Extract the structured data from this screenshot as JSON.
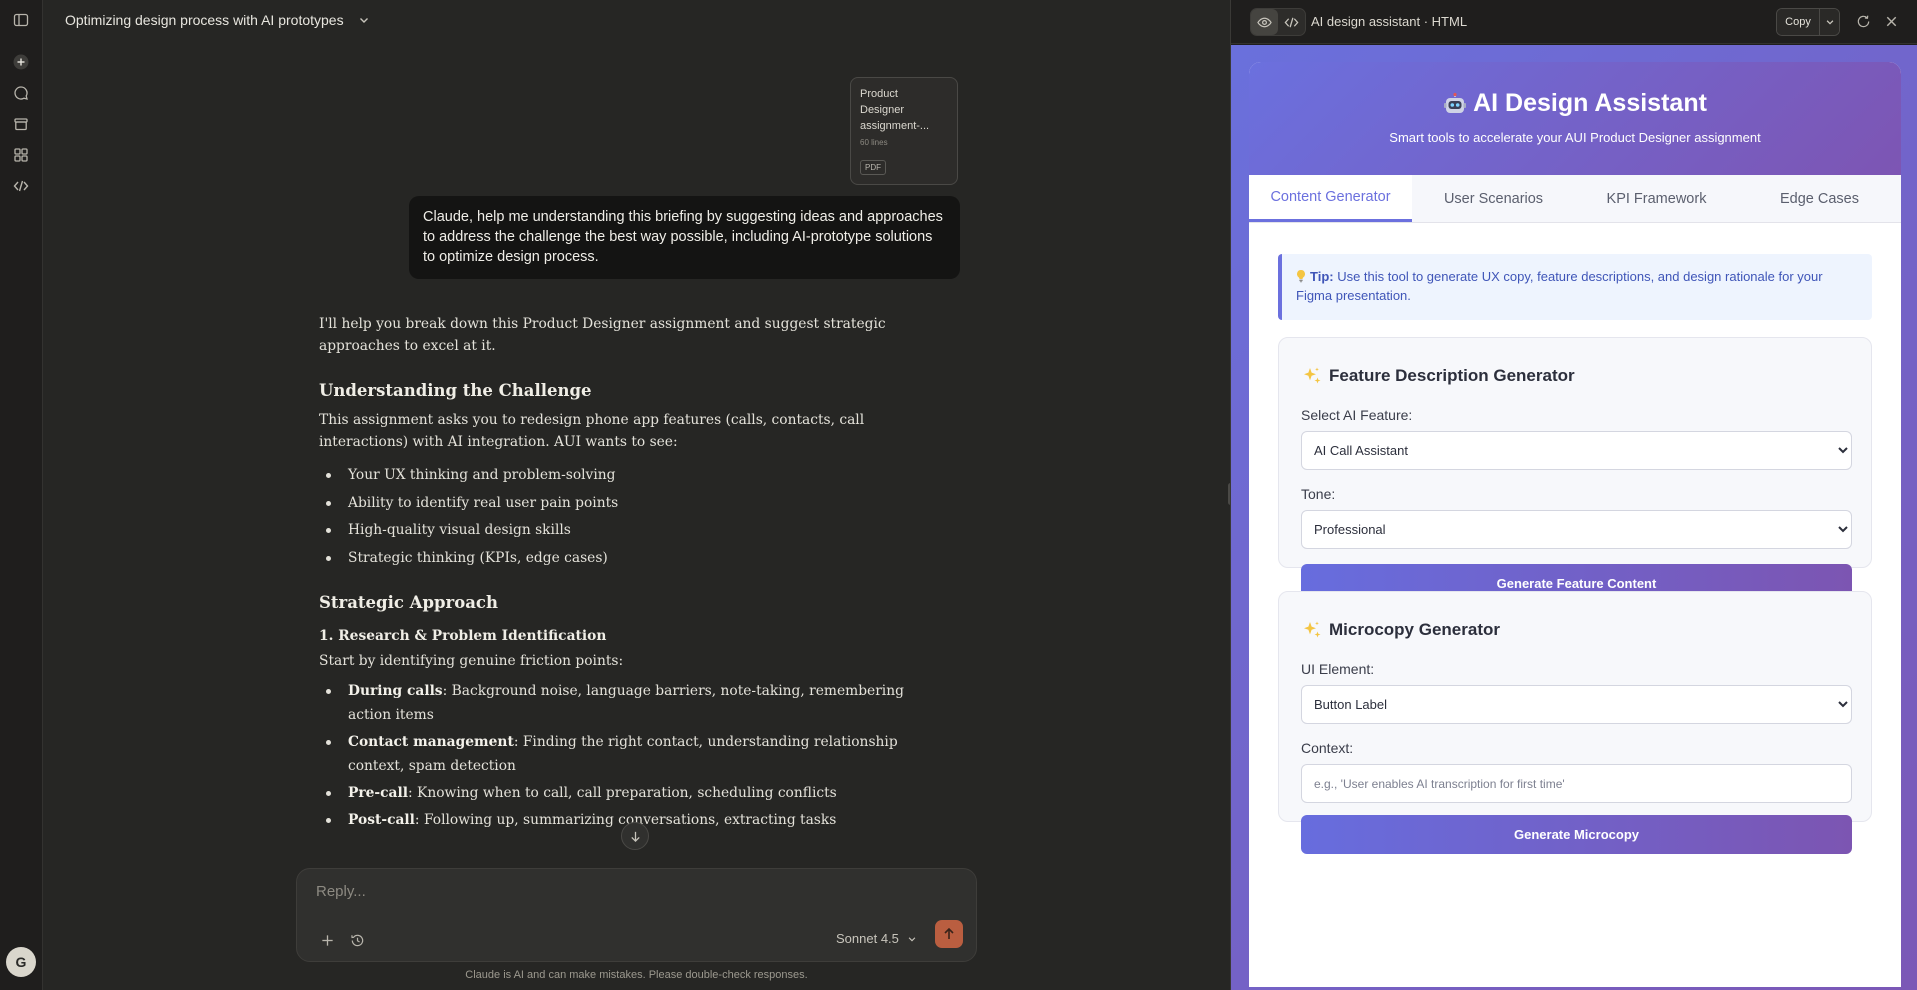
{
  "sidebar": {
    "icons": [
      "sidebar-toggle-icon",
      "new-chat-icon",
      "chats-icon",
      "projects-icon",
      "artifacts-icon",
      "code-icon"
    ],
    "avatar_initial": "G"
  },
  "header": {
    "conversation_title": "Optimizing design process with AI prototypes"
  },
  "attachment": {
    "title": "Product Designer assignment-...",
    "lines": "60 lines",
    "type": "PDF"
  },
  "user_message": "Claude, help me understanding this briefing by suggesting ideas and approaches to address the challenge the best way possible, including AI-prototype solutions to optimize design process.",
  "answer": {
    "intro": "I'll help you break down this Product Designer assignment and suggest strategic approaches to excel at it.",
    "h1": "Understanding the Challenge",
    "p1": "This assignment asks you to redesign phone app features (calls, contacts, call interactions) with AI integration. AUI wants to see:",
    "list1": [
      "Your UX thinking and problem-solving",
      "Ability to identify real user pain points",
      "High-quality visual design skills",
      "Strategic thinking (KPIs, edge cases)"
    ],
    "h2": "Strategic Approach",
    "h3": "1. Research & Problem Identification",
    "p2": "Start by identifying genuine friction points:",
    "list2": [
      {
        "bold": "During calls",
        "text": ": Background noise, language barriers, note-taking, remembering action items"
      },
      {
        "bold": "Contact management",
        "text": ": Finding the right contact, understanding relationship context, spam detection"
      },
      {
        "bold": "Pre-call",
        "text": ": Knowing when to call, call preparation, scheduling conflicts"
      },
      {
        "bold": "Post-call",
        "text": ": Following up, summarizing conversations, extracting tasks"
      }
    ]
  },
  "composer": {
    "placeholder": "Reply...",
    "model": "Sonnet 4.5",
    "disclaimer": "Claude is AI and can make mistakes. Please double-check responses."
  },
  "artifact": {
    "title": "AI design assistant · HTML",
    "copy_label": "Copy",
    "app": {
      "title": "AI Design Assistant",
      "subtitle": "Smart tools to accelerate your AUI Product Designer assignment",
      "tabs": [
        "Content Generator",
        "User Scenarios",
        "KPI Framework",
        "Edge Cases"
      ],
      "active_tab": 0,
      "tip_label": "Tip:",
      "tip_text": " Use this tool to generate UX copy, feature descriptions, and design rationale for your Figma presentation.",
      "feature_card": {
        "title": "Feature Description Generator",
        "feature_label": "Select AI Feature:",
        "feature_value": "AI Call Assistant",
        "tone_label": "Tone:",
        "tone_value": "Professional",
        "button": "Generate Feature Content"
      },
      "microcopy_card": {
        "title": "Microcopy Generator",
        "element_label": "UI Element:",
        "element_value": "Button Label",
        "context_label": "Context:",
        "context_placeholder": "e.g., 'User enables AI transcription for first time'",
        "button": "Generate Microcopy"
      }
    }
  },
  "colors": {
    "accent": "#6b70de",
    "accent2": "#7c55b2",
    "send": "#c96442",
    "bg": "#262624"
  }
}
